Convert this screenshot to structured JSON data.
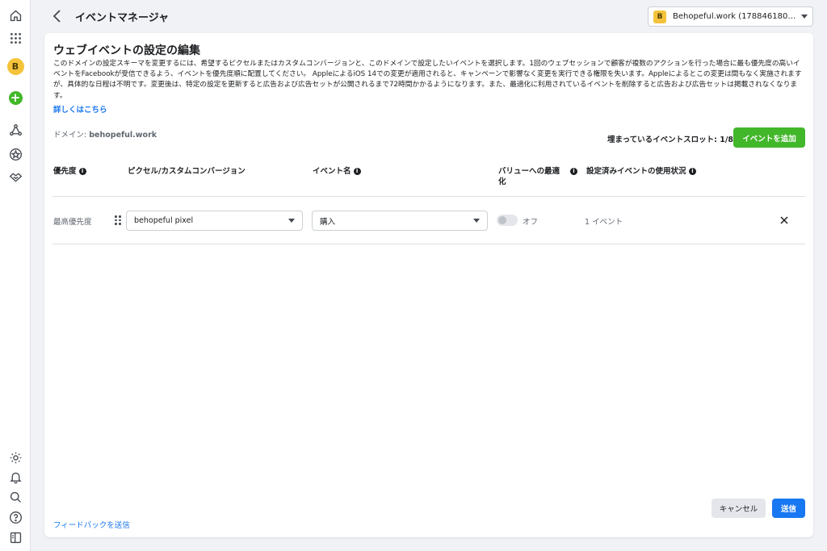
{
  "header": {
    "title": "イベントマネージャ",
    "account_badge": "B",
    "account_name": "Behopeful.work (17884618065777..."
  },
  "rail": {
    "avatar_letter": "B"
  },
  "card": {
    "title": "ウェブイベントの設定の編集",
    "description": "このドメインの設定スキーマを変更するには、希望するピクセルまたはカスタムコンバージョンと、このドメインで設定したいイベントを選択します。1回のウェブセッションで顧客が複数のアクションを行った場合に最も優先度の高いイベントをFacebookが受信できるよう、イベントを優先度順に配置してください。 AppleによるiOS 14での変更が適用されると、キャンペーンで影響なく変更を実行できる権限を失います。Appleによるとこの変更は間もなく実施されますが、具体的な日程は不明です。変更後は、特定の設定を更新すると広告および広告セットが公開されるまで72時間かかるようになります。また、最適化に利用されているイベントを削除すると広告および広告セットは掲載されなくなります。",
    "learn_more": "詳しくはこちら",
    "domain_label": "ドメイン:",
    "domain_value": "behopeful.work",
    "slots_text": "埋まっているイベントスロット: 1/8",
    "add_event_button": "イベントを追加",
    "columns": {
      "priority": "優先度",
      "pixel": "ピクセル/カスタムコンバージョン",
      "event_name": "イベント名",
      "value_opt": "バリューへの最適化",
      "usage": "設定済みイベントの使用状況"
    },
    "rows": [
      {
        "priority": "最高優先度",
        "pixel": "behopeful pixel",
        "event": "購入",
        "toggle_label": "オフ",
        "usage": "1 イベント"
      }
    ],
    "feedback": "フィードバックを送信",
    "cancel_button": "キャンセル",
    "submit_button": "送信"
  }
}
